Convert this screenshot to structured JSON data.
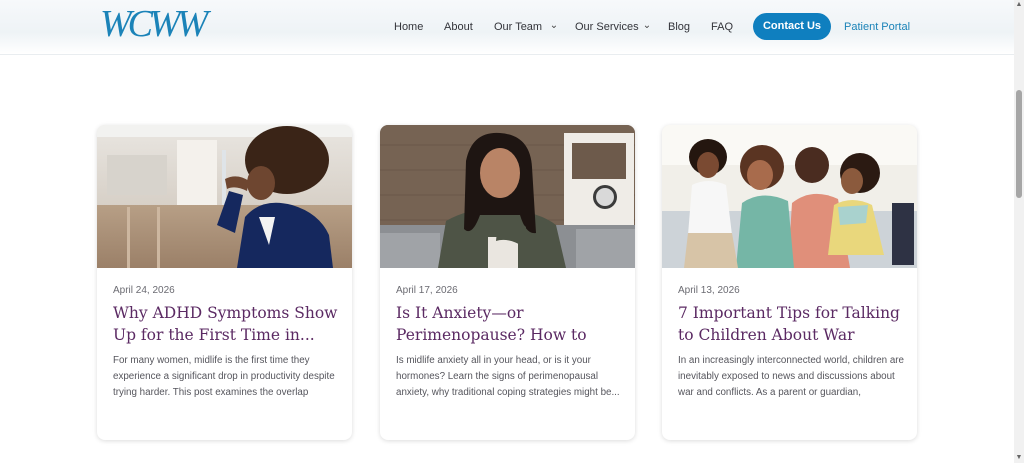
{
  "header": {
    "logo_text": "WCWW",
    "nav": [
      {
        "label": "Home"
      },
      {
        "label": "About"
      },
      {
        "label": "Our Team",
        "has_dropdown": true
      },
      {
        "label": "Our Services",
        "has_dropdown": true
      },
      {
        "label": "Blog"
      },
      {
        "label": "FAQ"
      }
    ],
    "contact_label": "Contact Us",
    "portal_label": "Patient Portal"
  },
  "colors": {
    "brand_blue": "#0f7fbf",
    "title_purple": "#5b2a63"
  },
  "posts": [
    {
      "date": "April 24, 2026",
      "title": "Why ADHD Symptoms Show Up for the First Time in...",
      "excerpt": "For many women, midlife is the first time they experience a significant drop in productivity despite trying harder. This post examines the overlap betwe...",
      "image": "woman-in-office-stressed-photo"
    },
    {
      "date": "April 17, 2026",
      "title": "Is It Anxiety—or Perimenopause? How to Tel...",
      "excerpt": "Is midlife anxiety all in your head, or is it your hormones? Learn the signs of perimenopausal anxiety, why traditional coping strategies might be...",
      "image": "woman-on-couch-anxious-photo"
    },
    {
      "date": "April 13, 2026",
      "title": "7 Important Tips for Talking to Children About War",
      "excerpt": "In an increasingly interconnected world, children are inevitably exposed to news and discussions about war and conflicts. As a parent or guardian, navigating su...",
      "image": "family-on-sofa-photo"
    }
  ]
}
